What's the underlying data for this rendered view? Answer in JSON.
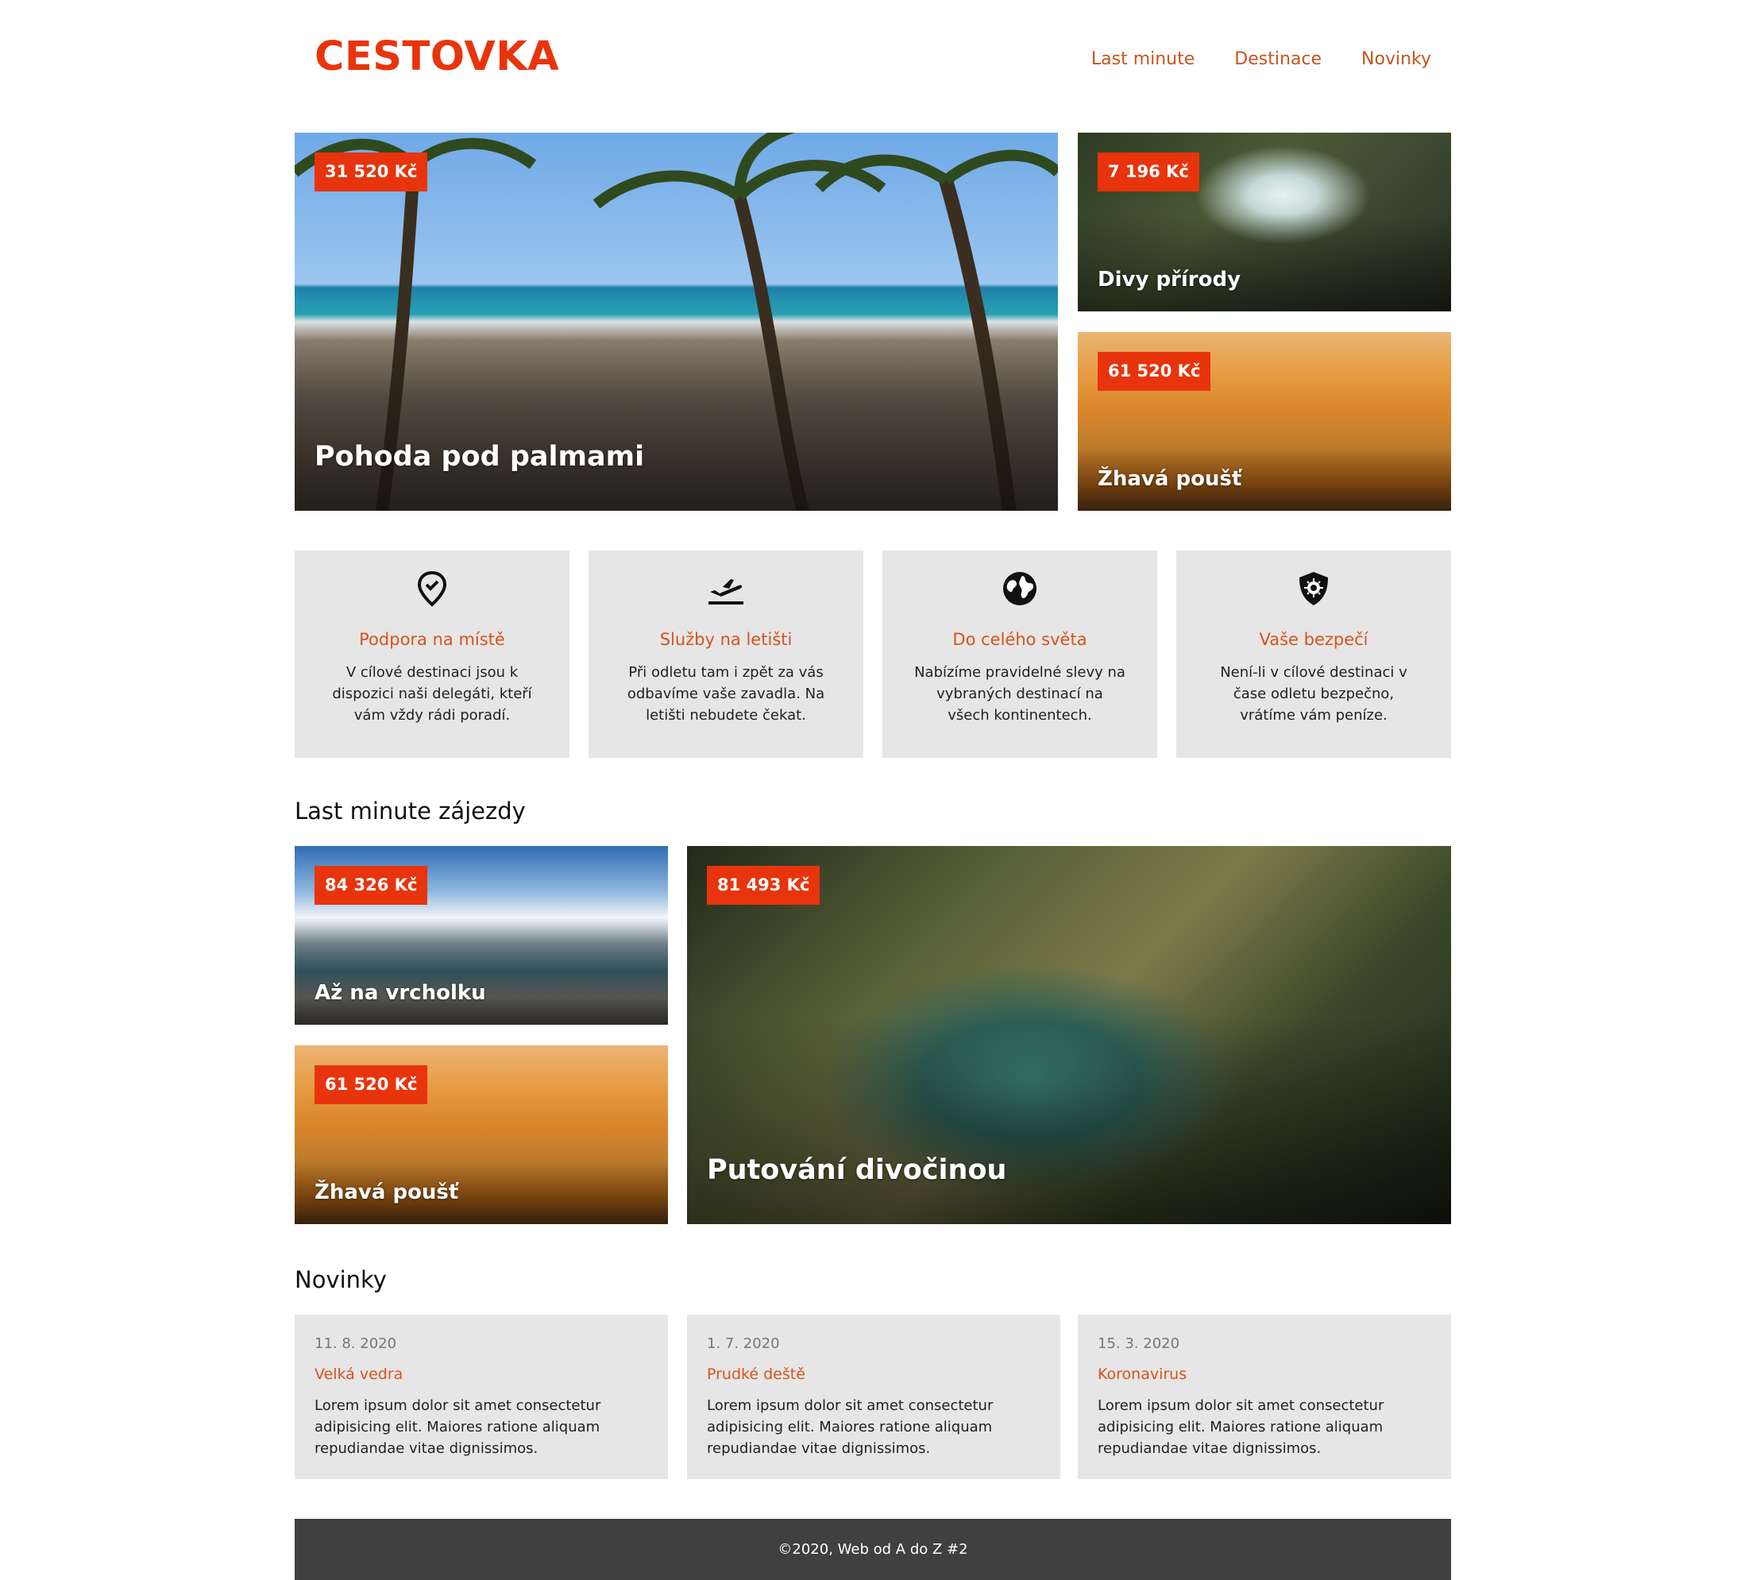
{
  "header": {
    "logo": "CESTOVKA",
    "nav": [
      "Last minute",
      "Destinace",
      "Novinky"
    ]
  },
  "hero": [
    {
      "price": "31 520 Kč",
      "title": "Pohoda pod palmami"
    },
    {
      "price": "7 196 Kč",
      "title": "Divy přírody"
    },
    {
      "price": "61 520 Kč",
      "title": "Žhavá poušť"
    }
  ],
  "features": [
    {
      "icon": "location-check-icon",
      "title": "Podpora na místě",
      "text": "V cílové destinaci jsou k dispozici naši delegáti, kteří vám vždy rádi poradí."
    },
    {
      "icon": "airplane-takeoff-icon",
      "title": "Služby na letišti",
      "text": "Při odletu tam i zpět za vás odbavíme vaše zavadla. Na letišti nebudete čekat."
    },
    {
      "icon": "globe-icon",
      "title": "Do celého světa",
      "text": "Nabízíme pravidelné slevy na vybraných destinací na všech kontinentech."
    },
    {
      "icon": "shield-virus-icon",
      "title": "Vaše bezpečí",
      "text": "Není-li v cílové destinaci v čase odletu bezpečno, vrátíme vám peníze."
    }
  ],
  "last_minute": {
    "title": "Last minute zájezdy",
    "items": [
      {
        "price": "84 326 Kč",
        "title": "Až na vrcholku"
      },
      {
        "price": "61 520 Kč",
        "title": "Žhavá poušť"
      },
      {
        "price": "81 493 Kč",
        "title": "Putování divočinou"
      }
    ]
  },
  "news": {
    "title": "Novinky",
    "items": [
      {
        "date": "11. 8. 2020",
        "title": "Velká vedra",
        "text": "Lorem ipsum dolor sit amet consectetur adipisicing elit. Maiores ratione aliquam repudiandae vitae dignissimos."
      },
      {
        "date": "1. 7. 2020",
        "title": "Prudké deště",
        "text": "Lorem ipsum dolor sit amet consectetur adipisicing elit. Maiores ratione aliquam repudiandae vitae dignissimos."
      },
      {
        "date": "15. 3. 2020",
        "title": "Koronavirus",
        "text": "Lorem ipsum dolor sit amet consectetur adipisicing elit. Maiores ratione aliquam repudiandae vitae dignissimos."
      }
    ]
  },
  "footer": {
    "text": "©2020, Web od A do Z #2"
  },
  "colors": {
    "accent": "#e8340c",
    "link": "#c9541c",
    "box": "#e6e6e6",
    "footer": "#404040"
  }
}
